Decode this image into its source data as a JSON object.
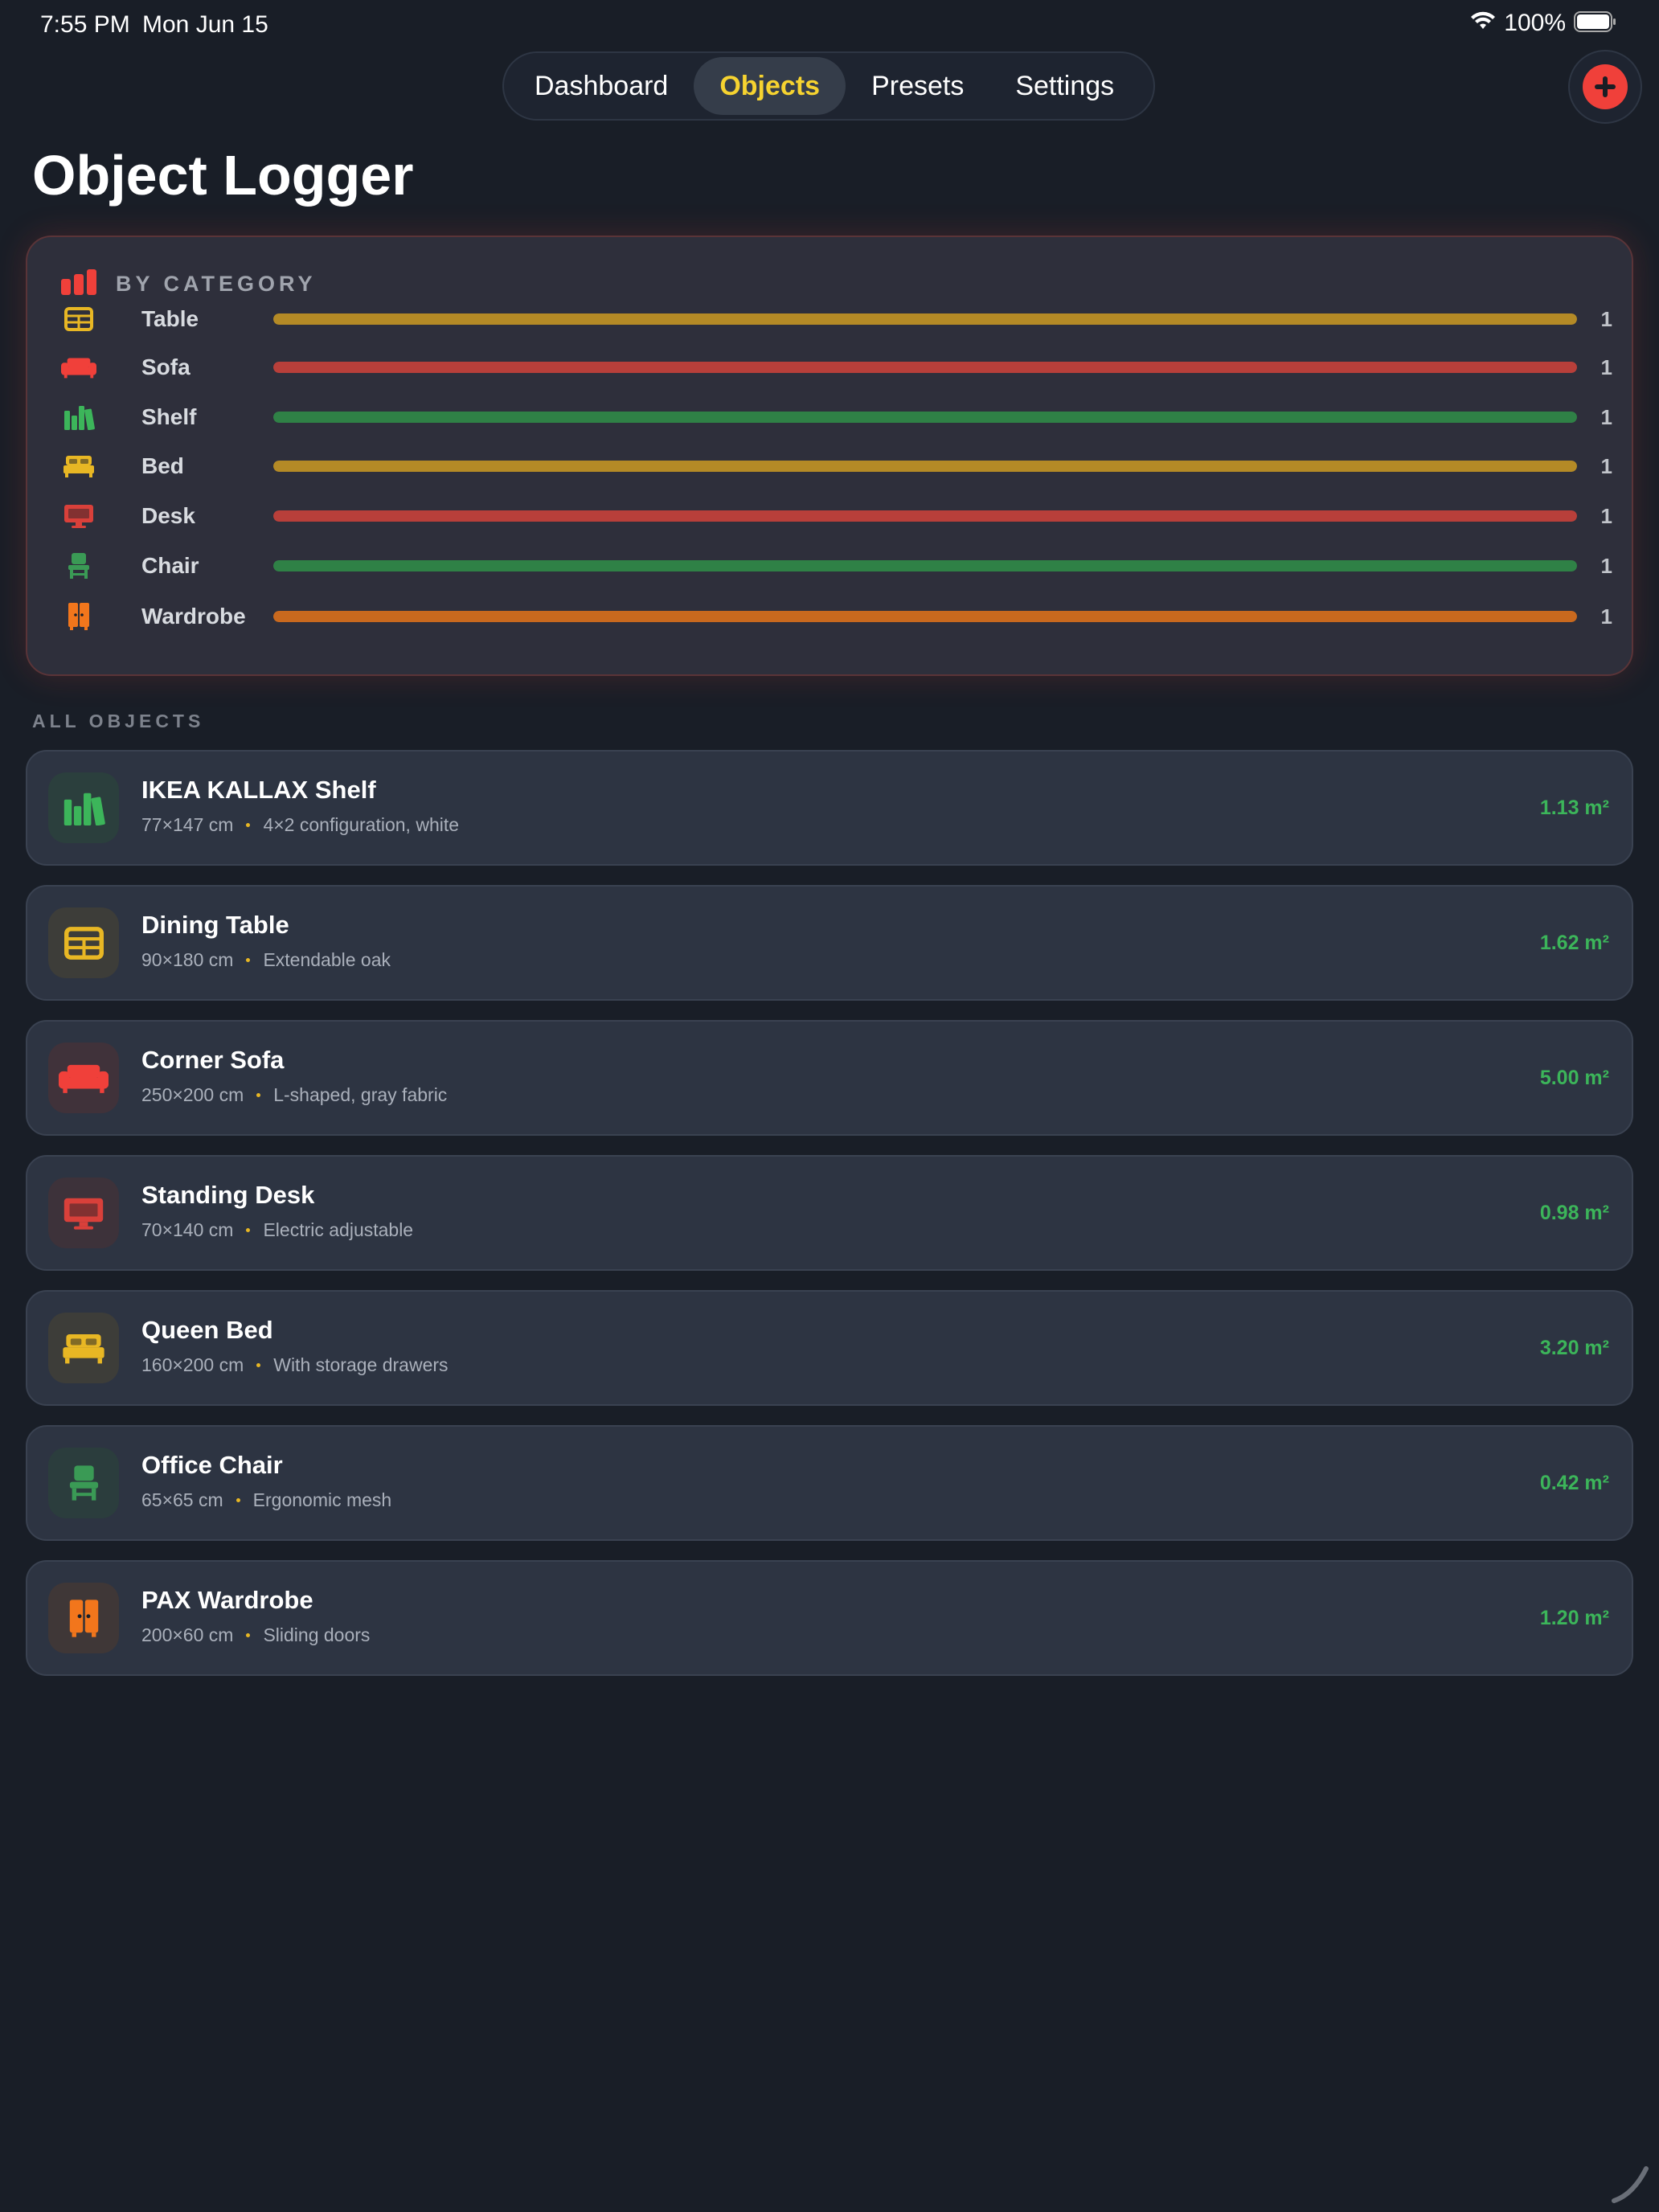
{
  "status_bar": {
    "time": "7:55 PM",
    "date": "Mon Jun 15",
    "battery": "100%",
    "icons": [
      "wifi-icon",
      "battery-icon"
    ]
  },
  "nav": {
    "tabs": [
      {
        "label": "Dashboard",
        "active": false
      },
      {
        "label": "Objects",
        "active": true
      },
      {
        "label": "Presets",
        "active": false
      },
      {
        "label": "Settings",
        "active": false
      }
    ],
    "add_icon": "plus-icon"
  },
  "page": {
    "title": "Object Logger"
  },
  "categories": {
    "header": "BY CATEGORY",
    "header_icon": "bar-chart-icon",
    "items": [
      {
        "name": "Table",
        "count": "1",
        "fraction": 1.0,
        "color": "#b48a26",
        "icon": "table-icon",
        "icon_color": "#e8b724"
      },
      {
        "name": "Sofa",
        "count": "1",
        "fraction": 1.0,
        "color": "#b83f3a",
        "icon": "sofa-icon",
        "icon_color": "#f0403a"
      },
      {
        "name": "Shelf",
        "count": "1",
        "fraction": 1.0,
        "color": "#2f8146",
        "icon": "shelf-icon",
        "icon_color": "#3cb55a"
      },
      {
        "name": "Bed",
        "count": "1",
        "fraction": 1.0,
        "color": "#b48a26",
        "icon": "bed-icon",
        "icon_color": "#e8b724"
      },
      {
        "name": "Desk",
        "count": "1",
        "fraction": 1.0,
        "color": "#b83f3a",
        "icon": "monitor-icon",
        "icon_color": "#d9403a"
      },
      {
        "name": "Chair",
        "count": "1",
        "fraction": 1.0,
        "color": "#2f8146",
        "icon": "chair-icon",
        "icon_color": "#3a9a55"
      },
      {
        "name": "Wardrobe",
        "count": "1",
        "fraction": 1.0,
        "color": "#c9691e",
        "icon": "wardrobe-icon",
        "icon_color": "#f2761c"
      }
    ]
  },
  "objects": {
    "header": "ALL OBJECTS",
    "items": [
      {
        "name": "IKEA KALLAX Shelf",
        "dims": "77×147 cm",
        "note": "4×2 configuration, white",
        "area": "1.13 m²",
        "icon": "shelf-icon",
        "icon_color": "#3cb55a",
        "icon_bg": "#2b3f3d"
      },
      {
        "name": "Dining Table",
        "dims": "90×180 cm",
        "note": "Extendable oak",
        "area": "1.62 m²",
        "icon": "table-icon",
        "icon_color": "#e8b724",
        "icon_bg": "#3d3d39"
      },
      {
        "name": "Corner Sofa",
        "dims": "250×200 cm",
        "note": "L-shaped, gray fabric",
        "area": "5.00 m²",
        "icon": "sofa-icon",
        "icon_color": "#f0403a",
        "icon_bg": "#40323a"
      },
      {
        "name": "Standing Desk",
        "dims": "70×140 cm",
        "note": "Electric adjustable",
        "area": "0.98 m²",
        "icon": "monitor-icon",
        "icon_color": "#d9403a",
        "icon_bg": "#3d323a"
      },
      {
        "name": "Queen Bed",
        "dims": "160×200 cm",
        "note": "With storage drawers",
        "area": "3.20 m²",
        "icon": "bed-icon",
        "icon_color": "#e8b724",
        "icon_bg": "#3d3d39"
      },
      {
        "name": "Office Chair",
        "dims": "65×65 cm",
        "note": "Ergonomic mesh",
        "area": "0.42 m²",
        "icon": "chair-icon",
        "icon_color": "#3a9a55",
        "icon_bg": "#2b3d3d"
      },
      {
        "name": "PAX Wardrobe",
        "dims": "200×60 cm",
        "note": "Sliding doors",
        "area": "1.20 m²",
        "icon": "wardrobe-icon",
        "icon_color": "#f2761c",
        "icon_bg": "#3f3737"
      }
    ]
  },
  "colors": {
    "background": "#191e27",
    "accent": "#f6d330",
    "add_button": "#f0403a",
    "area_text": "#3cb55a"
  }
}
